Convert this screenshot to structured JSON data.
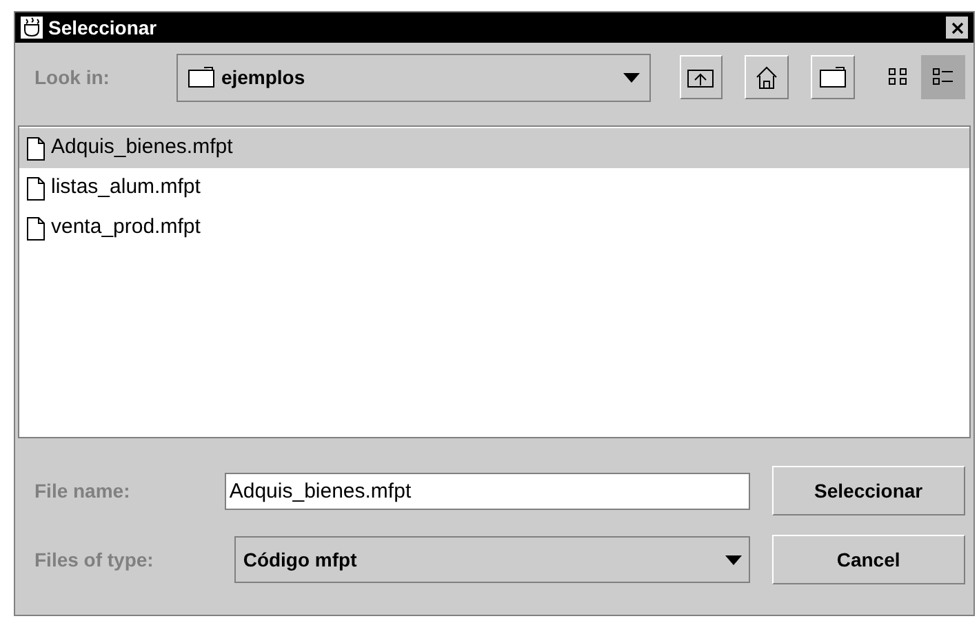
{
  "window": {
    "title": "Seleccionar"
  },
  "look_in": {
    "label": "Look in:",
    "value": "ejemplos"
  },
  "view_modes": [
    {
      "kind": "list",
      "selected": false
    },
    {
      "kind": "details",
      "selected": true
    }
  ],
  "files": [
    {
      "name": "Adquis_bienes.mfpt",
      "selected": true
    },
    {
      "name": "listas_alum.mfpt",
      "selected": false
    },
    {
      "name": "venta_prod.mfpt",
      "selected": false
    }
  ],
  "file_name": {
    "label": "File name:",
    "value": "Adquis_bienes.mfpt"
  },
  "file_type": {
    "label": "Files of type:",
    "value": "Código mfpt"
  },
  "buttons": [
    "Seleccionar",
    "Cancel"
  ]
}
